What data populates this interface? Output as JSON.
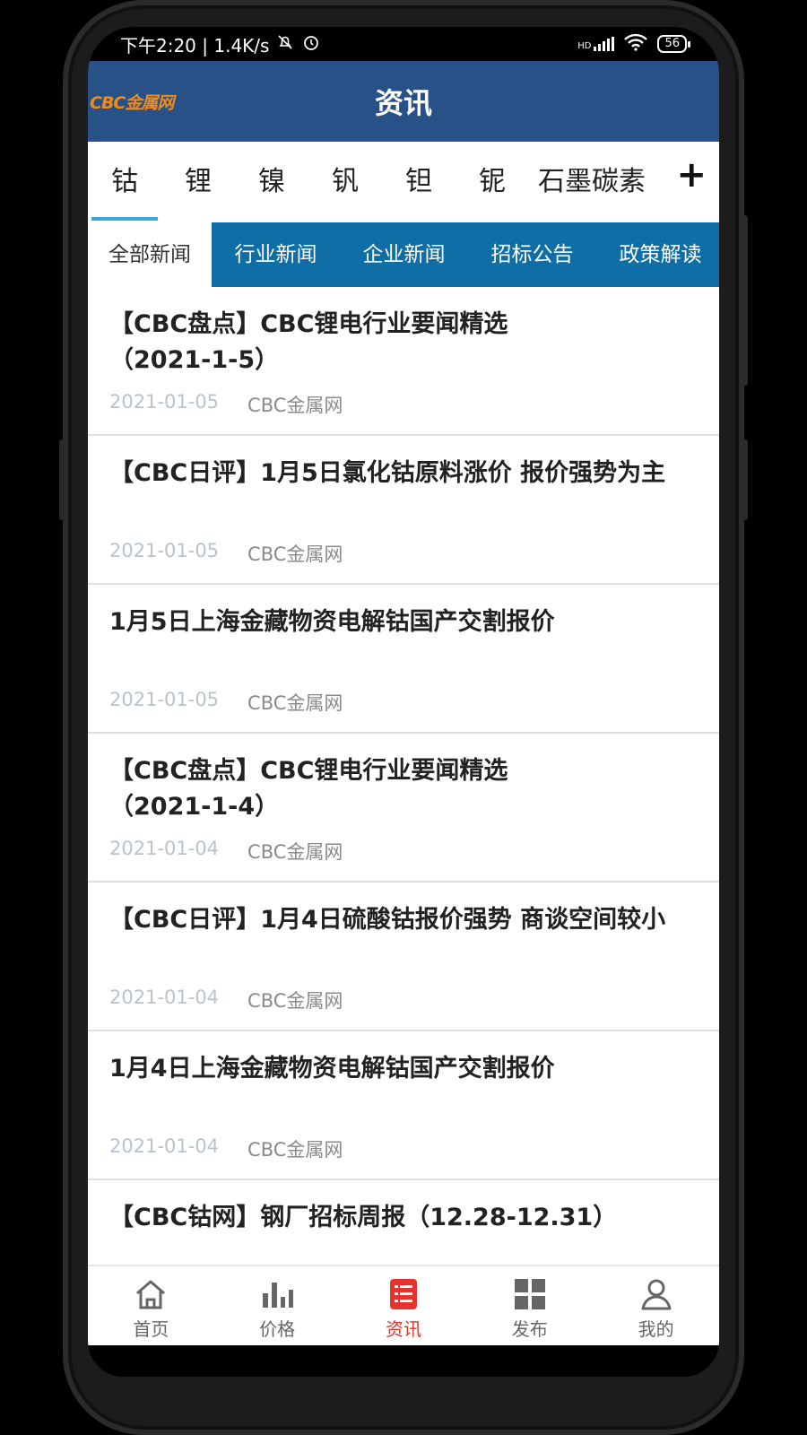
{
  "statusbar": {
    "time_speed": "下午2:20 | 1.4K/s",
    "battery": "56",
    "icons": [
      "mute-bell-icon",
      "alarm-icon",
      "hd-signal-icon",
      "wifi-icon",
      "battery-icon"
    ]
  },
  "header": {
    "logo": "CBC金属网",
    "title": "资讯",
    "color": "#275187"
  },
  "metal_tabs": {
    "items": [
      "钴",
      "锂",
      "镍",
      "钒",
      "钽",
      "铌",
      "石墨碳素"
    ],
    "active": "钴",
    "add_icon": "+",
    "accent": "#3aa6d8"
  },
  "category_tabs": {
    "items": [
      "全部新闻",
      "行业新闻",
      "企业新闻",
      "招标公告",
      "政策解读"
    ],
    "active": "全部新闻",
    "color": "#0f6ea5"
  },
  "news": [
    {
      "title": "【CBC盘点】CBC锂电行业要闻精选（2021-1-5）",
      "date": "2021-01-05",
      "source": "CBC金属网"
    },
    {
      "title": "【CBC日评】1月5日氯化钴原料涨价 报价强势为主",
      "date": "2021-01-05",
      "source": "CBC金属网"
    },
    {
      "title": "1月5日上海金藏物资电解钴国产交割报价",
      "date": "2021-01-05",
      "source": "CBC金属网"
    },
    {
      "title": "【CBC盘点】CBC锂电行业要闻精选（2021-1-4）",
      "date": "2021-01-04",
      "source": "CBC金属网"
    },
    {
      "title": "【CBC日评】1月4日硫酸钴报价强势 商谈空间较小",
      "date": "2021-01-04",
      "source": "CBC金属网"
    },
    {
      "title": "1月4日上海金藏物资电解钴国产交割报价",
      "date": "2021-01-04",
      "source": "CBC金属网"
    },
    {
      "title": "【CBC钴网】钢厂招标周报（12.28-12.31）",
      "date": "",
      "source": ""
    }
  ],
  "bottom_nav": {
    "items": [
      {
        "label": "首页",
        "icon": "home-icon"
      },
      {
        "label": "价格",
        "icon": "bar-chart-icon"
      },
      {
        "label": "资讯",
        "icon": "news-icon"
      },
      {
        "label": "发布",
        "icon": "grid-icon"
      },
      {
        "label": "我的",
        "icon": "user-icon"
      }
    ],
    "active": "资讯",
    "active_color": "#e5342d"
  }
}
